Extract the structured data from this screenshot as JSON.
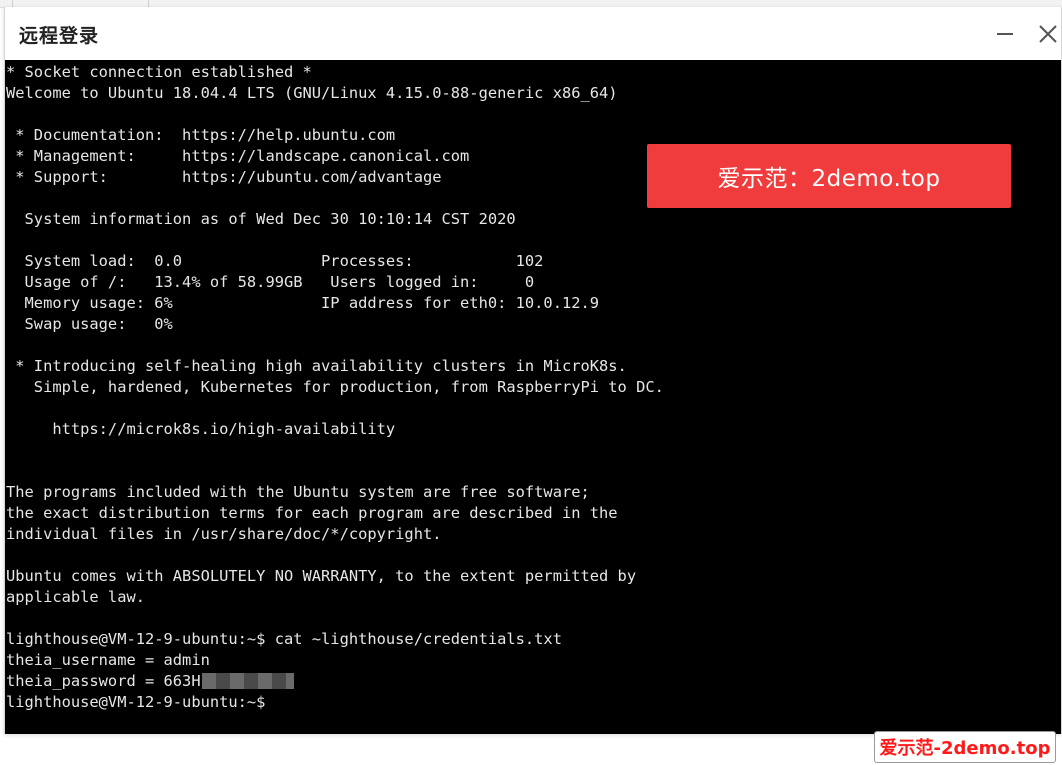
{
  "window": {
    "title": "远程登录",
    "minimize_icon": "minimize-icon",
    "close_icon": "close-icon"
  },
  "terminal": {
    "lines": [
      "* Socket connection established *",
      "Welcome to Ubuntu 18.04.4 LTS (GNU/Linux 4.15.0-88-generic x86_64)",
      "",
      " * Documentation:  https://help.ubuntu.com",
      " * Management:     https://landscape.canonical.com",
      " * Support:        https://ubuntu.com/advantage",
      "",
      "  System information as of Wed Dec 30 10:10:14 CST 2020",
      "",
      "  System load:  0.0               Processes:           102",
      "  Usage of /:   13.4% of 58.99GB   Users logged in:     0",
      "  Memory usage: 6%                IP address for eth0: 10.0.12.9",
      "  Swap usage:   0%",
      "",
      " * Introducing self-healing high availability clusters in MicroK8s.",
      "   Simple, hardened, Kubernetes for production, from RaspberryPi to DC.",
      "",
      "     https://microk8s.io/high-availability",
      "",
      "",
      "The programs included with the Ubuntu system are free software;",
      "the exact distribution terms for each program are described in the",
      "individual files in /usr/share/doc/*/copyright.",
      "",
      "Ubuntu comes with ABSOLUTELY NO WARRANTY, to the extent permitted by",
      "applicable law.",
      "",
      "lighthouse@VM-12-9-ubuntu:~$ cat ~lighthouse/credentials.txt",
      "theia_username = admin",
      "theia_password = 663H",
      "lighthouse@VM-12-9-ubuntu:~$"
    ],
    "redacted_line_index": 29,
    "background": "#000000",
    "foreground": "#e6e6e6"
  },
  "overlay": {
    "banner_text": "爱示范：2demo.top",
    "banner_color": "#f03c3c",
    "badge_text": "爱示范-2demo.top",
    "badge_color": "#ff1a1a"
  }
}
